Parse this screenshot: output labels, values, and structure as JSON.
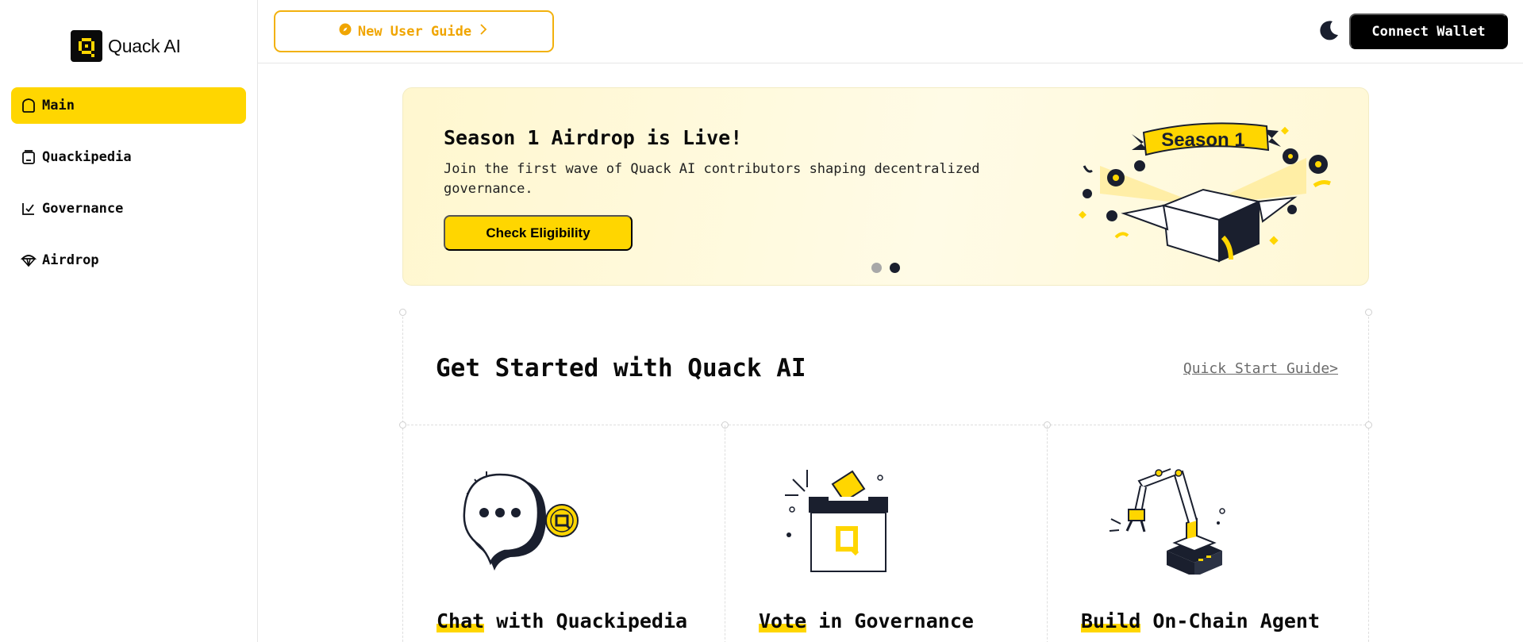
{
  "brand": {
    "name": "Quack AI"
  },
  "sidebar": {
    "items": [
      {
        "label": "Main",
        "icon": "home-icon",
        "active": true
      },
      {
        "label": "Quackipedia",
        "icon": "book-icon",
        "active": false
      },
      {
        "label": "Governance",
        "icon": "chart-check-icon",
        "active": false
      },
      {
        "label": "Airdrop",
        "icon": "parachute-icon",
        "active": false
      }
    ]
  },
  "header": {
    "guide_label": "New User Guide",
    "wallet_label": "Connect Wallet",
    "theme_icon": "moon-icon"
  },
  "banner": {
    "title": "Season 1 Airdrop is Live!",
    "text": "Join the first wave of Quack AI contributors shaping decentralized governance.",
    "button": "Check Eligibility",
    "art_label": "Season 1",
    "slides": 2,
    "active_slide": 2
  },
  "get_started": {
    "title": "Get Started with Quack AI",
    "link": "Quick Start Guide>",
    "cards": [
      {
        "highlight": "Chat",
        "rest": " with Quackipedia"
      },
      {
        "highlight": "Vote",
        "rest": " in Governance"
      },
      {
        "highlight": "Build",
        "rest": " On-Chain Agent"
      }
    ]
  },
  "colors": {
    "accent": "#ffd600",
    "dark": "#1a1f2e",
    "guide": "#f0a500"
  }
}
